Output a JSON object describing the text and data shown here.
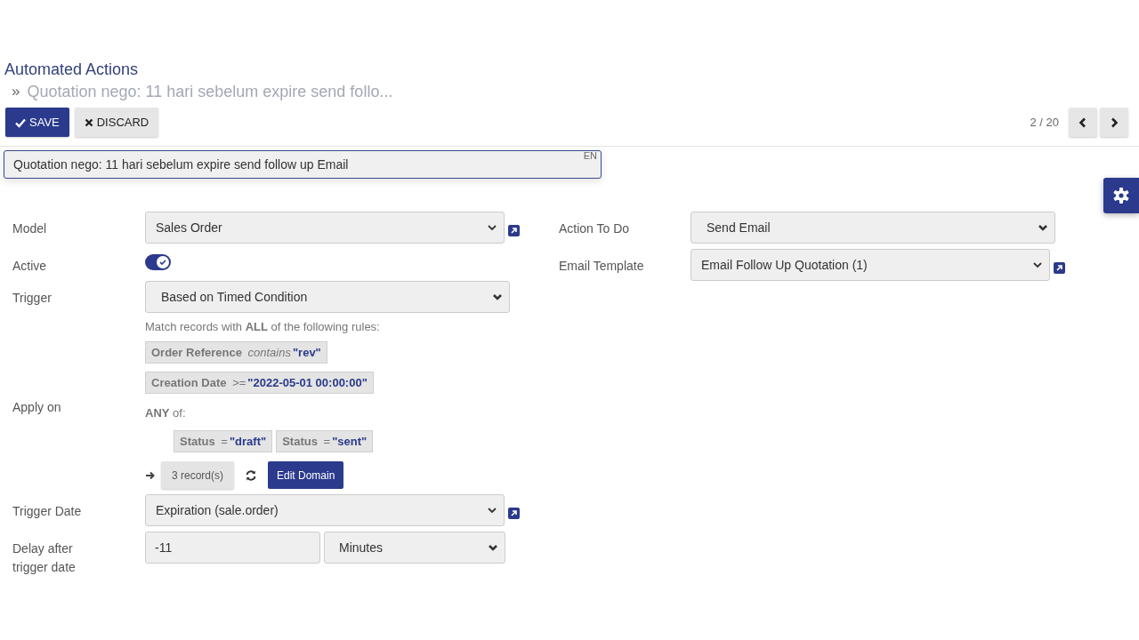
{
  "breadcrumb": {
    "parent": "Automated Actions",
    "separator": "»",
    "current": "Quotation nego: 11 hari sebelum expire send follo..."
  },
  "buttons": [
    {
      "kind": "primary",
      "label": "SAVE"
    },
    {
      "kind": "secondary",
      "label": "DISCARD"
    }
  ],
  "pager": {
    "value": "2 / 20"
  },
  "name_field": {
    "value": "Quotation nego: 11 hari sebelum expire send follow up Email",
    "language": "EN"
  },
  "left_fields": [
    {
      "kind": "select",
      "label": "Model",
      "value": "Sales Order",
      "link": true
    },
    {
      "kind": "toggle",
      "label": "Active",
      "on": true
    },
    {
      "kind": "select",
      "label": "Trigger",
      "value": "Based on Timed Condition",
      "link": false
    },
    {
      "kind": "domain",
      "label": "Apply on",
      "intro": "Match records with **ALL** of the following rules:",
      "rules": [
        {
          "field": "Order Reference",
          "operator": "*contains*",
          "value": "\"rev\""
        },
        {
          "field": "Creation Date",
          "operator": ">=",
          "value": "\"2022-05-01 00:00:00\""
        }
      ],
      "any_label": "**ANY** of:",
      "any_rules": [
        {
          "field": "Status",
          "operator": "=",
          "value": "\"draft\""
        },
        {
          "field": "Status",
          "operator": "=",
          "value": "\"sent\""
        }
      ],
      "count": "3 record(s)",
      "edit_button": "Edit Domain"
    },
    {
      "kind": "select",
      "label": "Trigger Date",
      "value": "Expiration (sale.order)",
      "link": true
    },
    {
      "kind": "delay",
      "label": "Delay after trigger date",
      "value": "-11",
      "unit": "Minutes"
    }
  ],
  "right_fields": [
    {
      "kind": "select",
      "label": "Action To Do",
      "value": "Send Email",
      "link": false
    },
    {
      "kind": "select",
      "label": "Email Template",
      "value": "Email Follow Up Quotation (1)",
      "link": true
    }
  ]
}
